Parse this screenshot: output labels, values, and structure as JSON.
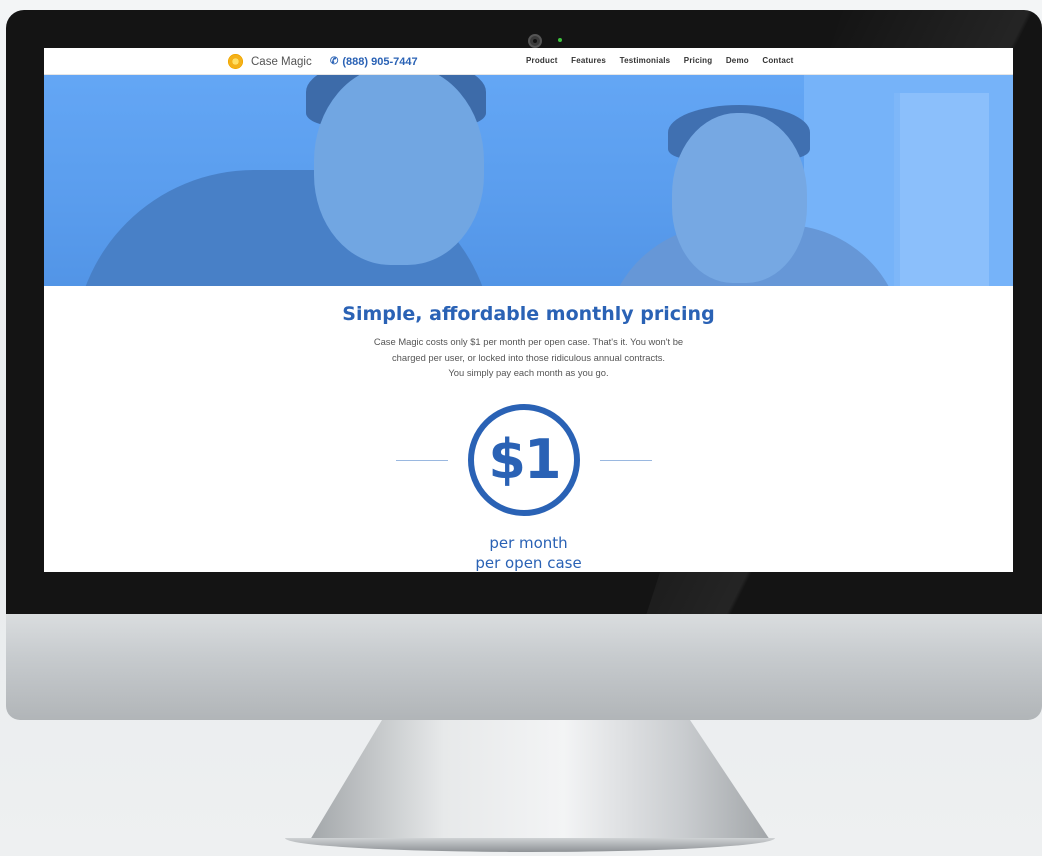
{
  "site": {
    "logo_text": "Case Magic",
    "phone": "(888) 905-7447"
  },
  "nav": {
    "links": [
      "Product",
      "Features",
      "Testimonials",
      "Pricing",
      "Demo",
      "Contact"
    ]
  },
  "pricing": {
    "headline": "Simple, affordable monthly pricing",
    "desc_line1": "Case Magic costs only $1 per month per open case. That's it. You won't be",
    "desc_line2": "charged per user, or locked into those ridiculous annual contracts.",
    "desc_line3": "You simply pay each month as you go.",
    "price": "$1",
    "per_line1": "per month",
    "per_line2": "per open case"
  },
  "colors": {
    "brand_blue": "#2a62b5",
    "hero_blue": "#5b9be9"
  },
  "icons": {
    "logo": "sun-logo-icon",
    "phone": "phone-icon",
    "camera": "webcam-icon"
  }
}
